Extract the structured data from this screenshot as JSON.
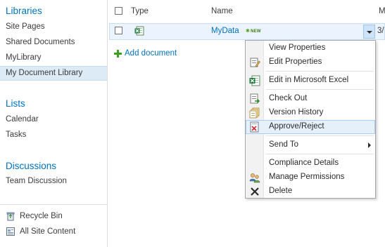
{
  "nav": {
    "libraries_heading": "Libraries",
    "library_items": [
      "Site Pages",
      "Shared Documents",
      "MyLibrary",
      "My Document Library"
    ],
    "lists_heading": "Lists",
    "list_items": [
      "Calendar",
      "Tasks"
    ],
    "discussions_heading": "Discussions",
    "discussion_items": [
      "Team Discussion"
    ],
    "recycle_bin": "Recycle Bin",
    "all_site_content": "All Site Content"
  },
  "list": {
    "col_type": "Type",
    "col_name": "Name",
    "col_modified_partial": "M",
    "doc_name": "MyData",
    "new_badge": "NEW",
    "modified_partial": "3/",
    "add_document": "Add document"
  },
  "menu": {
    "view_properties": "View Properties",
    "edit_properties": "Edit Properties",
    "edit_in_excel": "Edit in Microsoft Excel",
    "check_out": "Check Out",
    "version_history": "Version History",
    "approve_reject": "Approve/Reject",
    "send_to": "Send To",
    "compliance_details": "Compliance Details",
    "manage_permissions": "Manage Permissions",
    "delete": "Delete"
  },
  "colors": {
    "link_blue": "#0072bc",
    "selection_blue": "#ddebf6",
    "hover_blue": "#e6f0fb",
    "excel_green": "#1d7a3a"
  }
}
